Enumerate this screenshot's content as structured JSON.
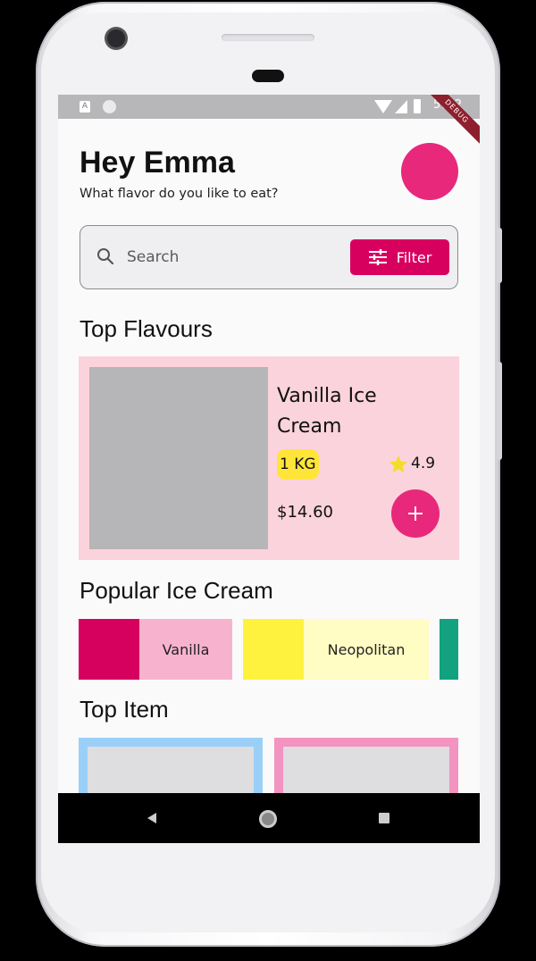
{
  "status_bar": {
    "time": "5:12",
    "debug_label": "DEBUG",
    "notification_letter": "A"
  },
  "header": {
    "greeting": "Hey Emma",
    "subtitle": "What flavor do you like to eat?"
  },
  "search": {
    "placeholder": "Search",
    "filter_label": "Filter"
  },
  "sections": {
    "top_flavours": "Top Flavours",
    "popular": "Popular Ice Cream",
    "top_item": "Top Item"
  },
  "featured": {
    "name": "Vanilla Ice Cream",
    "weight": "1 KG",
    "rating": "4.9",
    "price": "$14.60"
  },
  "popular_items": [
    {
      "label": "Vanilla",
      "swatch": "#d6005f",
      "background": "#f7b3cd"
    },
    {
      "label": "Neopolitan",
      "swatch": "#fff23f",
      "background": "#fffcc4"
    },
    {
      "label": "",
      "swatch": "#13a27f",
      "background": "#13a27f"
    }
  ],
  "top_items": [
    {
      "border": "#9ad0f7"
    },
    {
      "border": "#f393c0"
    }
  ],
  "colors": {
    "accent": "#d8005f",
    "avatar": "#e8287b",
    "card": "#fbd3dc",
    "badge": "#ffe53a",
    "star": "#f5dc2a"
  }
}
